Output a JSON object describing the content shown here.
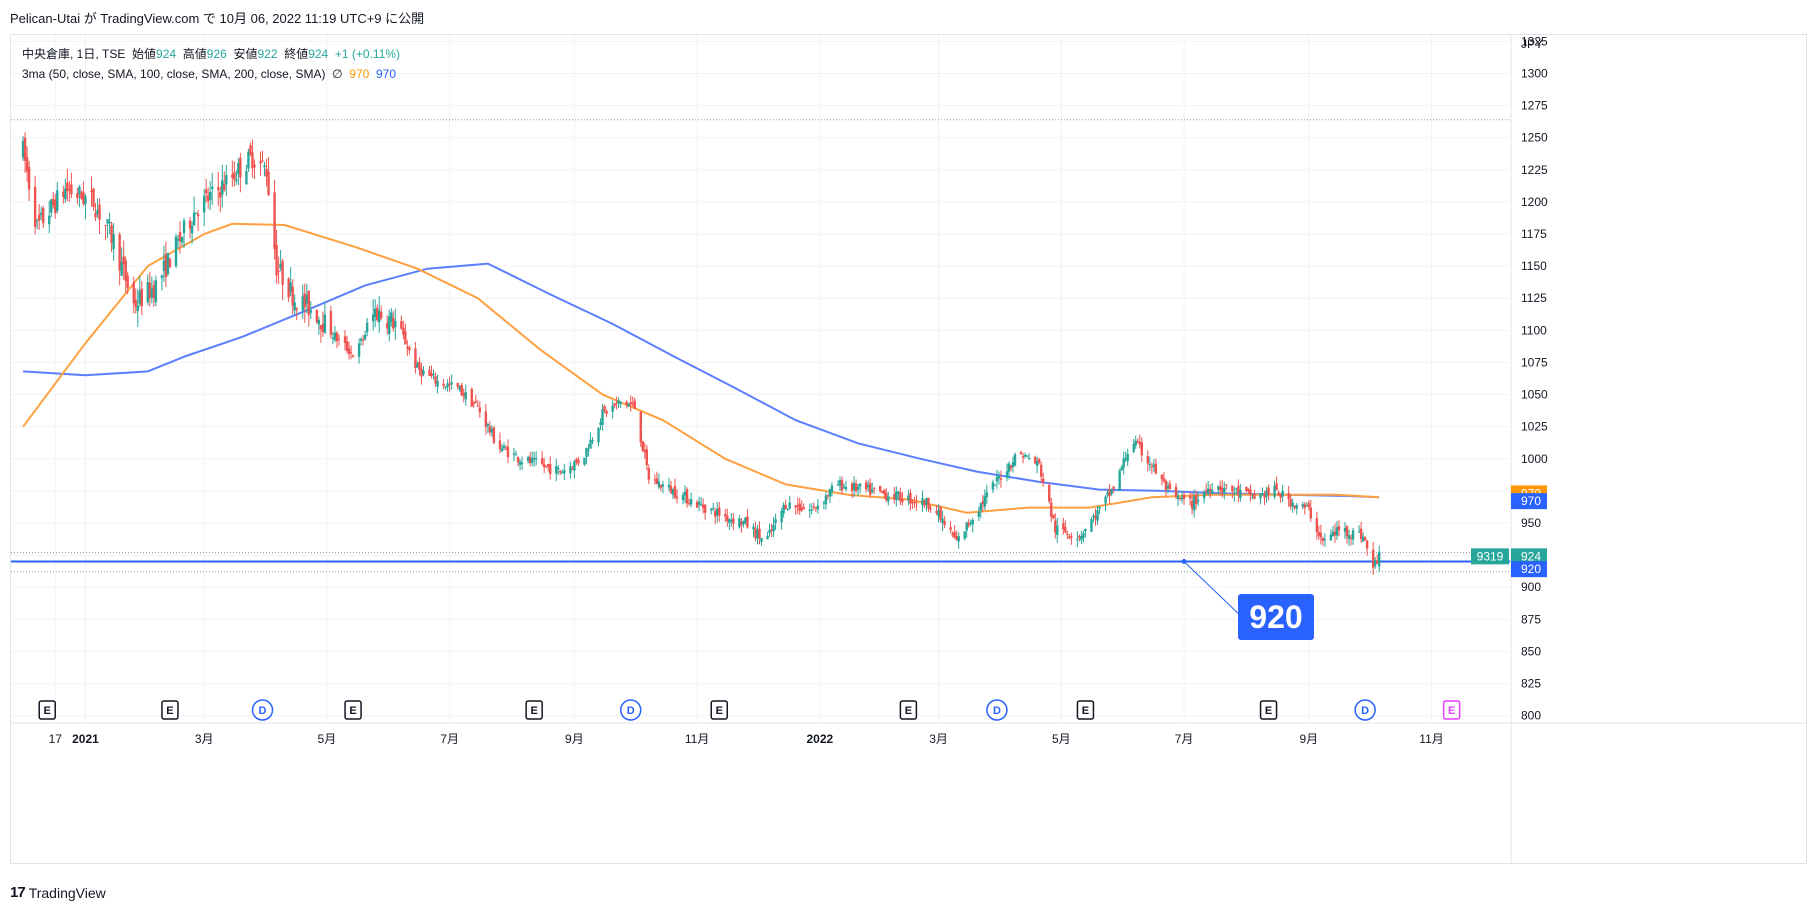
{
  "publish_header": "Pelican-Utai が TradingView.com で 10月 06, 2022 11:19 UTC+9 に公開",
  "legend": {
    "symbol": "中央倉庫, 1日, TSE",
    "open_label": "始値",
    "open_value": "924",
    "high_label": "高値",
    "high_value": "926",
    "low_label": "安値",
    "low_value": "922",
    "close_label": "終値",
    "close_value": "924",
    "change": "+1 (+0.11%)",
    "indicator": "3ma (50, close, SMA, 100, close, SMA, 200, close, SMA)",
    "indicator_symbol": "∅",
    "ma1_value": "970",
    "ma2_value": "970"
  },
  "footer": {
    "logo": "17",
    "brand": "TradingView"
  },
  "colors": {
    "up": "#26a69a",
    "down": "#ef5350",
    "ma50": "#ff9800",
    "ma100": "#2962ff",
    "grid": "#f0f3fa",
    "hline": "#2962ff"
  },
  "chart_data": {
    "type": "candlestick",
    "currency": "JPY",
    "y_ticks": [
      800,
      825,
      850,
      875,
      900,
      925,
      950,
      975,
      1000,
      1025,
      1050,
      1075,
      1100,
      1125,
      1150,
      1175,
      1200,
      1225,
      1250,
      1275,
      1300,
      1325
    ],
    "y_ticks_shown": [
      800,
      825,
      850,
      875,
      900,
      950,
      1000,
      1025,
      1050,
      1075,
      1100,
      1125,
      1150,
      1175,
      1200,
      1225,
      1250,
      1275,
      1300,
      1325
    ],
    "ylim": [
      795,
      1330
    ],
    "x_ticks": [
      {
        "label": "17",
        "date": "2020-12-17",
        "bold": false
      },
      {
        "label": "2021",
        "date": "2021-01-01",
        "bold": true
      },
      {
        "label": "3月",
        "date": "2021-03-01",
        "bold": false
      },
      {
        "label": "5月",
        "date": "2021-05-01",
        "bold": false
      },
      {
        "label": "7月",
        "date": "2021-07-01",
        "bold": false
      },
      {
        "label": "9月",
        "date": "2021-09-01",
        "bold": false
      },
      {
        "label": "11月",
        "date": "2021-11-01",
        "bold": false
      },
      {
        "label": "2022",
        "date": "2022-01-01",
        "bold": true
      },
      {
        "label": "3月",
        "date": "2022-03-01",
        "bold": false
      },
      {
        "label": "5月",
        "date": "2022-05-01",
        "bold": false
      },
      {
        "label": "7月",
        "date": "2022-07-01",
        "bold": false
      },
      {
        "label": "9月",
        "date": "2022-09-01",
        "bold": false
      },
      {
        "label": "11月",
        "date": "2022-11-01",
        "bold": false
      }
    ],
    "close_path": [
      [
        "2020-12-01",
        1240
      ],
      [
        "2020-12-08",
        1180
      ],
      [
        "2020-12-15",
        1195
      ],
      [
        "2020-12-22",
        1210
      ],
      [
        "2021-01-05",
        1200
      ],
      [
        "2021-01-15",
        1170
      ],
      [
        "2021-01-25",
        1120
      ],
      [
        "2021-02-05",
        1135
      ],
      [
        "2021-02-15",
        1165
      ],
      [
        "2021-02-25",
        1195
      ],
      [
        "2021-03-05",
        1205
      ],
      [
        "2021-03-15",
        1220
      ],
      [
        "2021-03-25",
        1235
      ],
      [
        "2021-04-01",
        1225
      ],
      [
        "2021-04-06",
        1150
      ],
      [
        "2021-04-15",
        1125
      ],
      [
        "2021-04-25",
        1115
      ],
      [
        "2021-05-05",
        1095
      ],
      [
        "2021-05-15",
        1080
      ],
      [
        "2021-05-25",
        1115
      ],
      [
        "2021-06-05",
        1105
      ],
      [
        "2021-06-15",
        1070
      ],
      [
        "2021-06-25",
        1060
      ],
      [
        "2021-07-05",
        1055
      ],
      [
        "2021-07-15",
        1040
      ],
      [
        "2021-07-25",
        1010
      ],
      [
        "2021-08-05",
        1000
      ],
      [
        "2021-08-15",
        995
      ],
      [
        "2021-08-25",
        990
      ],
      [
        "2021-09-05",
        1000
      ],
      [
        "2021-09-15",
        1035
      ],
      [
        "2021-09-25",
        1045
      ],
      [
        "2021-10-01",
        1040
      ],
      [
        "2021-10-08",
        985
      ],
      [
        "2021-10-20",
        975
      ],
      [
        "2021-11-01",
        965
      ],
      [
        "2021-11-15",
        955
      ],
      [
        "2021-11-25",
        950
      ],
      [
        "2021-12-05",
        935
      ],
      [
        "2021-12-15",
        965
      ],
      [
        "2021-12-28",
        960
      ],
      [
        "2022-01-10",
        980
      ],
      [
        "2022-01-25",
        975
      ],
      [
        "2022-02-10",
        970
      ],
      [
        "2022-02-25",
        965
      ],
      [
        "2022-03-10",
        935
      ],
      [
        "2022-03-20",
        960
      ],
      [
        "2022-03-31",
        985
      ],
      [
        "2022-04-10",
        1005
      ],
      [
        "2022-04-20",
        995
      ],
      [
        "2022-04-28",
        945
      ],
      [
        "2022-05-10",
        940
      ],
      [
        "2022-05-20",
        960
      ],
      [
        "2022-05-28",
        980
      ],
      [
        "2022-06-05",
        1015
      ],
      [
        "2022-06-15",
        995
      ],
      [
        "2022-06-25",
        970
      ],
      [
        "2022-07-05",
        965
      ],
      [
        "2022-07-15",
        980
      ],
      [
        "2022-07-25",
        975
      ],
      [
        "2022-08-05",
        970
      ],
      [
        "2022-08-15",
        975
      ],
      [
        "2022-08-25",
        965
      ],
      [
        "2022-09-01",
        960
      ],
      [
        "2022-09-08",
        935
      ],
      [
        "2022-09-16",
        945
      ],
      [
        "2022-09-28",
        940
      ],
      [
        "2022-10-03",
        915
      ],
      [
        "2022-10-06",
        924
      ]
    ],
    "ma50_path": [
      [
        "2020-12-01",
        1025
      ],
      [
        "2021-01-01",
        1090
      ],
      [
        "2021-02-01",
        1150
      ],
      [
        "2021-03-01",
        1175
      ],
      [
        "2021-03-15",
        1183
      ],
      [
        "2021-04-10",
        1182
      ],
      [
        "2021-05-15",
        1165
      ],
      [
        "2021-06-15",
        1148
      ],
      [
        "2021-07-15",
        1125
      ],
      [
        "2021-08-15",
        1085
      ],
      [
        "2021-09-15",
        1050
      ],
      [
        "2021-10-15",
        1030
      ],
      [
        "2021-11-15",
        1000
      ],
      [
        "2021-12-15",
        980
      ],
      [
        "2022-01-15",
        972
      ],
      [
        "2022-02-15",
        968
      ],
      [
        "2022-03-15",
        958
      ],
      [
        "2022-04-15",
        962
      ],
      [
        "2022-05-15",
        962
      ],
      [
        "2022-06-15",
        970
      ],
      [
        "2022-07-15",
        972
      ],
      [
        "2022-08-15",
        972
      ],
      [
        "2022-09-15",
        972
      ],
      [
        "2022-10-06",
        970
      ]
    ],
    "ma100_path": [
      [
        "2020-12-01",
        1068
      ],
      [
        "2021-01-01",
        1065
      ],
      [
        "2021-02-01",
        1068
      ],
      [
        "2021-02-20",
        1080
      ],
      [
        "2021-03-20",
        1095
      ],
      [
        "2021-04-20",
        1115
      ],
      [
        "2021-05-20",
        1135
      ],
      [
        "2021-06-20",
        1148
      ],
      [
        "2021-07-20",
        1152
      ],
      [
        "2021-08-20",
        1128
      ],
      [
        "2021-09-20",
        1105
      ],
      [
        "2021-10-20",
        1080
      ],
      [
        "2021-11-20",
        1055
      ],
      [
        "2021-12-20",
        1030
      ],
      [
        "2022-01-20",
        1012
      ],
      [
        "2022-02-20",
        1000
      ],
      [
        "2022-03-20",
        990
      ],
      [
        "2022-04-20",
        982
      ],
      [
        "2022-05-20",
        976
      ],
      [
        "2022-06-20",
        975
      ],
      [
        "2022-07-20",
        973
      ],
      [
        "2022-08-20",
        972
      ],
      [
        "2022-09-20",
        971
      ],
      [
        "2022-10-06",
        970
      ]
    ],
    "hlines": [
      {
        "value": 1264,
        "style": "dotted",
        "color": "#9598a1"
      },
      {
        "value": 927,
        "style": "dotted",
        "color": "#9598a1"
      },
      {
        "value": 920,
        "style": "solid",
        "color": "#2962ff"
      },
      {
        "value": 912,
        "style": "dotted",
        "color": "#9598a1"
      }
    ],
    "price_tags": [
      {
        "label": "970",
        "value": 973,
        "bg": "#ff9800"
      },
      {
        "label": "970",
        "value": 967,
        "bg": "#2962ff"
      },
      {
        "label": "924",
        "value": 924,
        "bg": "#26a69a"
      },
      {
        "label": "920",
        "value": 914,
        "bg": "#2962ff"
      }
    ],
    "countdown_tag": "9319",
    "annotation": {
      "text": "920",
      "anchor_date": "2022-07-01",
      "anchor_value": 920
    },
    "events": [
      {
        "type": "E",
        "date": "2020-12-13"
      },
      {
        "type": "E",
        "date": "2021-02-12"
      },
      {
        "type": "D",
        "date": "2021-03-30"
      },
      {
        "type": "E",
        "date": "2021-05-14"
      },
      {
        "type": "E",
        "date": "2021-08-12"
      },
      {
        "type": "D",
        "date": "2021-09-29"
      },
      {
        "type": "E",
        "date": "2021-11-12"
      },
      {
        "type": "E",
        "date": "2022-02-14"
      },
      {
        "type": "D",
        "date": "2022-03-30"
      },
      {
        "type": "E",
        "date": "2022-05-13"
      },
      {
        "type": "E",
        "date": "2022-08-12"
      },
      {
        "type": "D",
        "date": "2022-09-29"
      },
      {
        "type": "E",
        "date": "2022-11-11",
        "future": true
      }
    ]
  }
}
